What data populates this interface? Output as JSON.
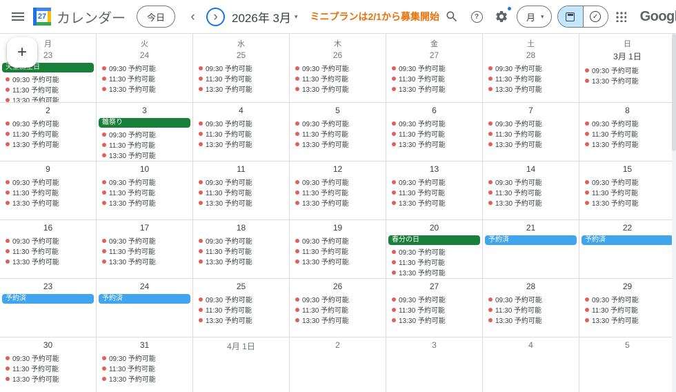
{
  "colors": {
    "holiday_green": "#188038",
    "reserved_blue": "#41a5ee",
    "slot_dot_red": "#e06055",
    "banner_orange": "#e8710a",
    "accent_blue": "#1a73e8"
  },
  "header": {
    "logo_day": "27",
    "app_title": "カレンダー",
    "today_button": "今日",
    "month_label": "2026年 3月",
    "banner_text": "ミニプランは2/1から募集開始",
    "view_selector_label": "月",
    "google_wordmark": "Google"
  },
  "icons": {
    "menu": "hamburger",
    "prev_chevron": "‹",
    "next_chevron": "›",
    "dropdown_caret": "▾",
    "search": "magnifier",
    "help_glyph": "?",
    "settings": "gear",
    "calendar_view": "calendar",
    "tasks_view_check": "✓",
    "apps": "grid-3x3",
    "create_plus": "+"
  },
  "weeks": [
    {
      "days": [
        {
          "weekday": "月",
          "date": "23",
          "muted": true,
          "bar": {
            "type": "holiday",
            "text": "天皇誕生日"
          },
          "slots": [
            "09:30 予約可能",
            "11:30 予約可能",
            "13:30 予約可能"
          ]
        },
        {
          "weekday": "火",
          "date": "24",
          "muted": true,
          "slots": [
            "09:30 予約可能",
            "11:30 予約可能",
            "13:30 予約可能"
          ]
        },
        {
          "weekday": "水",
          "date": "25",
          "muted": true,
          "slots": [
            "09:30 予約可能",
            "11:30 予約可能",
            "13:30 予約可能"
          ]
        },
        {
          "weekday": "木",
          "date": "26",
          "muted": true,
          "slots": [
            "09:30 予約可能",
            "11:30 予約可能",
            "13:30 予約可能"
          ]
        },
        {
          "weekday": "金",
          "date": "27",
          "muted": true,
          "slots": [
            "09:30 予約可能",
            "11:30 予約可能",
            "13:30 予約可能"
          ]
        },
        {
          "weekday": "土",
          "date": "28",
          "muted": true,
          "slots": [
            "09:30 予約可能",
            "11:30 予約可能",
            "13:30 予約可能"
          ]
        },
        {
          "weekday": "日",
          "date": "3月 1日",
          "muted": false,
          "slots": [
            "09:30 予約可能",
            "13:30 予約可能"
          ]
        }
      ]
    },
    {
      "days": [
        {
          "date": "2",
          "slots": [
            "09:30 予約可能",
            "11:30 予約可能",
            "13:30 予約可能"
          ]
        },
        {
          "date": "3",
          "bar": {
            "type": "holiday",
            "text": "雛祭り"
          },
          "slots": [
            "09:30 予約可能",
            "11:30 予約可能",
            "13:30 予約可能"
          ]
        },
        {
          "date": "4",
          "slots": [
            "09:30 予約可能",
            "11:30 予約可能",
            "13:30 予約可能"
          ]
        },
        {
          "date": "5",
          "slots": [
            "09:30 予約可能",
            "11:30 予約可能",
            "13:30 予約可能"
          ]
        },
        {
          "date": "6",
          "slots": [
            "09:30 予約可能",
            "11:30 予約可能",
            "13:30 予約可能"
          ]
        },
        {
          "date": "7",
          "slots": [
            "09:30 予約可能",
            "11:30 予約可能",
            "13:30 予約可能"
          ]
        },
        {
          "date": "8",
          "slots": [
            "09:30 予約可能",
            "11:30 予約可能",
            "13:30 予約可能"
          ]
        }
      ]
    },
    {
      "days": [
        {
          "date": "9",
          "slots": [
            "09:30 予約可能",
            "11:30 予約可能",
            "13:30 予約可能"
          ]
        },
        {
          "date": "10",
          "slots": [
            "09:30 予約可能",
            "11:30 予約可能",
            "13:30 予約可能"
          ]
        },
        {
          "date": "11",
          "slots": [
            "09:30 予約可能",
            "11:30 予約可能",
            "13:30 予約可能"
          ]
        },
        {
          "date": "12",
          "slots": [
            "09:30 予約可能",
            "11:30 予約可能",
            "13:30 予約可能"
          ]
        },
        {
          "date": "13",
          "slots": [
            "09:30 予約可能",
            "11:30 予約可能",
            "13:30 予約可能"
          ]
        },
        {
          "date": "14",
          "slots": [
            "09:30 予約可能",
            "11:30 予約可能",
            "13:30 予約可能"
          ]
        },
        {
          "date": "15",
          "slots": [
            "09:30 予約可能",
            "11:30 予約可能",
            "13:30 予約可能"
          ]
        }
      ]
    },
    {
      "days": [
        {
          "date": "16",
          "slots": [
            "09:30 予約可能",
            "11:30 予約可能",
            "13:30 予約可能"
          ]
        },
        {
          "date": "17",
          "slots": [
            "09:30 予約可能",
            "11:30 予約可能",
            "13:30 予約可能"
          ]
        },
        {
          "date": "18",
          "slots": [
            "09:30 予約可能",
            "11:30 予約可能",
            "13:30 予約可能"
          ]
        },
        {
          "date": "19",
          "slots": [
            "09:30 予約可能",
            "11:30 予約可能",
            "13:30 予約可能"
          ]
        },
        {
          "date": "20",
          "bar": {
            "type": "holiday",
            "text": "春分の日"
          },
          "slots": [
            "09:30 予約可能",
            "11:30 予約可能",
            "13:30 予約可能"
          ]
        },
        {
          "date": "21",
          "bar": {
            "type": "reserved",
            "text": "予約済"
          },
          "slots": []
        },
        {
          "date": "22",
          "bar": {
            "type": "reserved",
            "text": "予約済"
          },
          "slots": []
        }
      ]
    },
    {
      "days": [
        {
          "date": "23",
          "bar": {
            "type": "reserved",
            "text": "予約済"
          },
          "slots": []
        },
        {
          "date": "24",
          "bar": {
            "type": "reserved",
            "text": "予約済"
          },
          "slots": []
        },
        {
          "date": "25",
          "slots": [
            "09:30 予約可能",
            "11:30 予約可能",
            "13:30 予約可能"
          ]
        },
        {
          "date": "26",
          "slots": [
            "09:30 予約可能",
            "11:30 予約可能",
            "13:30 予約可能"
          ]
        },
        {
          "date": "27",
          "slots": [
            "09:30 予約可能",
            "11:30 予約可能",
            "13:30 予約可能"
          ]
        },
        {
          "date": "28",
          "slots": [
            "09:30 予約可能",
            "11:30 予約可能",
            "13:30 予約可能"
          ]
        },
        {
          "date": "29",
          "slots": [
            "09:30 予約可能",
            "11:30 予約可能",
            "13:30 予約可能"
          ]
        }
      ]
    },
    {
      "days": [
        {
          "date": "30",
          "slots": [
            "09:30 予約可能",
            "11:30 予約可能",
            "13:30 予約可能"
          ]
        },
        {
          "date": "31",
          "slots": [
            "09:30 予約可能",
            "11:30 予約可能",
            "13:30 予約可能"
          ]
        },
        {
          "date": "4月 1日",
          "muted": true,
          "slots": []
        },
        {
          "date": "2",
          "muted": true,
          "slots": []
        },
        {
          "date": "3",
          "muted": true,
          "slots": []
        },
        {
          "date": "4",
          "muted": true,
          "slots": []
        },
        {
          "date": "5",
          "muted": true,
          "slots": []
        }
      ]
    }
  ]
}
